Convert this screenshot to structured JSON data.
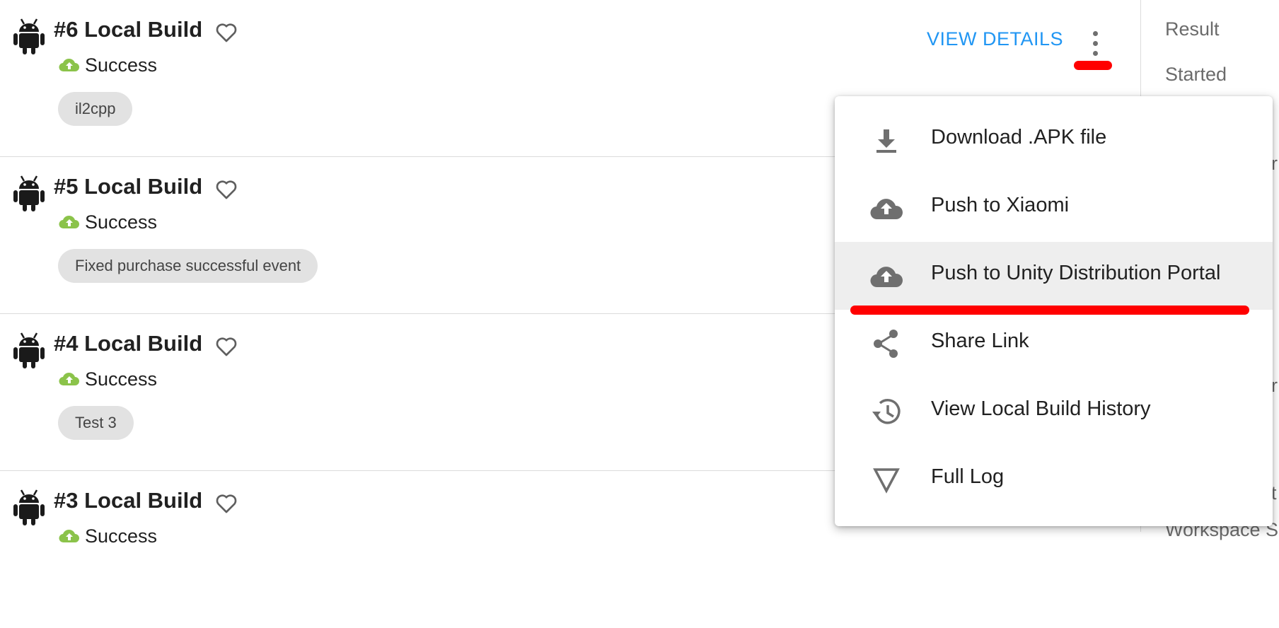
{
  "builds": [
    {
      "title": "#6 Local Build",
      "status": "Success",
      "tag": "il2cpp"
    },
    {
      "title": "#5 Local Build",
      "status": "Success",
      "tag": "Fixed purchase successful event"
    },
    {
      "title": "#4 Local Build",
      "status": "Success",
      "tag": "Test 3"
    },
    {
      "title": "#3 Local Build",
      "status": "Success",
      "tag": ""
    }
  ],
  "actions": {
    "view_details": "VIEW DETAILS"
  },
  "side_panel": {
    "labels": [
      "Result",
      "Started"
    ],
    "fragments": [
      "r",
      "r",
      "t"
    ],
    "bottom_fragment": "Workspace S"
  },
  "menu": {
    "items": [
      {
        "label": "Download .APK file",
        "icon": "download-icon"
      },
      {
        "label": "Push to Xiaomi",
        "icon": "cloud-upload-icon"
      },
      {
        "label": "Push to Unity Distribution Portal",
        "icon": "cloud-upload-icon",
        "highlighted": true
      },
      {
        "label": "Share Link",
        "icon": "share-icon"
      },
      {
        "label": "View Local Build History",
        "icon": "history-icon"
      },
      {
        "label": "Full Log",
        "icon": "triangle-down-icon"
      }
    ]
  },
  "colors": {
    "accent": "#2196f3",
    "success": "#8bc34a",
    "annotation": "#ff0000",
    "icon": "#6f6f6f"
  }
}
